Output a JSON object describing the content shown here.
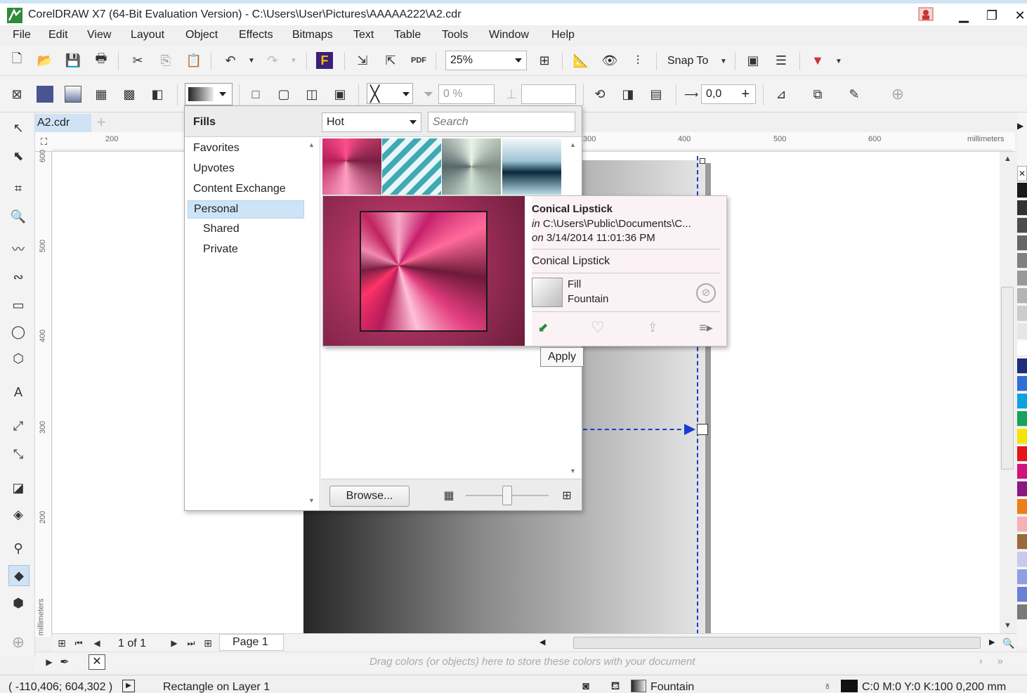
{
  "window": {
    "title": "CorelDRAW X7 (64-Bit Evaluation Version) - C:\\Users\\User\\Pictures\\AAAAA222\\A2.cdr"
  },
  "menu": [
    "File",
    "Edit",
    "View",
    "Layout",
    "Object",
    "Effects",
    "Bitmaps",
    "Text",
    "Table",
    "Tools",
    "Window",
    "Help"
  ],
  "toolbar": {
    "zoom_value": "25%",
    "snap_to_label": "Snap To"
  },
  "property_bar": {
    "transparency_value": "0 %",
    "offset_value": "0,0"
  },
  "document": {
    "tab_name": "A2.cdr"
  },
  "ruler": {
    "h_ticks": [
      "200",
      "300",
      "400",
      "500",
      "600"
    ],
    "h_unit": "millimeters",
    "v_ticks": [
      "600",
      "500",
      "400",
      "300",
      "200"
    ],
    "v_unit": "millimeters"
  },
  "fills_panel": {
    "header_label": "Fills",
    "category_value": "Hot",
    "search_placeholder": "Search",
    "nav_items": [
      "Favorites",
      "Upvotes",
      "Content Exchange",
      "Personal",
      "Shared",
      "Private"
    ],
    "selected_item": "Personal",
    "browse_label": "Browse..."
  },
  "fill_info": {
    "name": "Conical Lipstick",
    "location_prefix": "in",
    "location": "C:\\Users\\Public\\Documents\\C...",
    "date_prefix": "on",
    "date": "3/14/2014 11:01:36 PM",
    "title": "Conical Lipstick",
    "type_line1": "Fill",
    "type_line2": "Fountain",
    "apply_tooltip": "Apply"
  },
  "navigator": {
    "page_count": "1 of 1",
    "page_tab": "Page 1"
  },
  "color_bar": {
    "hint": "Drag colors (or objects) here to store these colors with your document"
  },
  "status": {
    "coordinates": "( -110,406; 604,302 )",
    "selection": "Rectangle on Layer 1",
    "fill_type": "Fountain",
    "outline": "C:0 M:0 Y:0 K:100  0,200 mm"
  },
  "colors": {
    "accent": "#cfe3f5",
    "selection": "#cde4f7",
    "guide": "#1a3bd6"
  },
  "palette_colors": [
    "#1a1a1a",
    "#333333",
    "#4d4d4d",
    "#666666",
    "#808080",
    "#999999",
    "#b3b3b3",
    "#cccccc",
    "#e6e6e6",
    "#ffffff",
    "#1e2d7a",
    "#2f6fd6",
    "#0aa3e0",
    "#16a35a",
    "#f2e600",
    "#e3151a",
    "#d1147b",
    "#8a1a80",
    "#f07d1a",
    "#f7b0b8",
    "#9a6a3a",
    "#c9c9f0",
    "#8fa0e0",
    "#6a7fd6",
    "#7a7a7a"
  ]
}
